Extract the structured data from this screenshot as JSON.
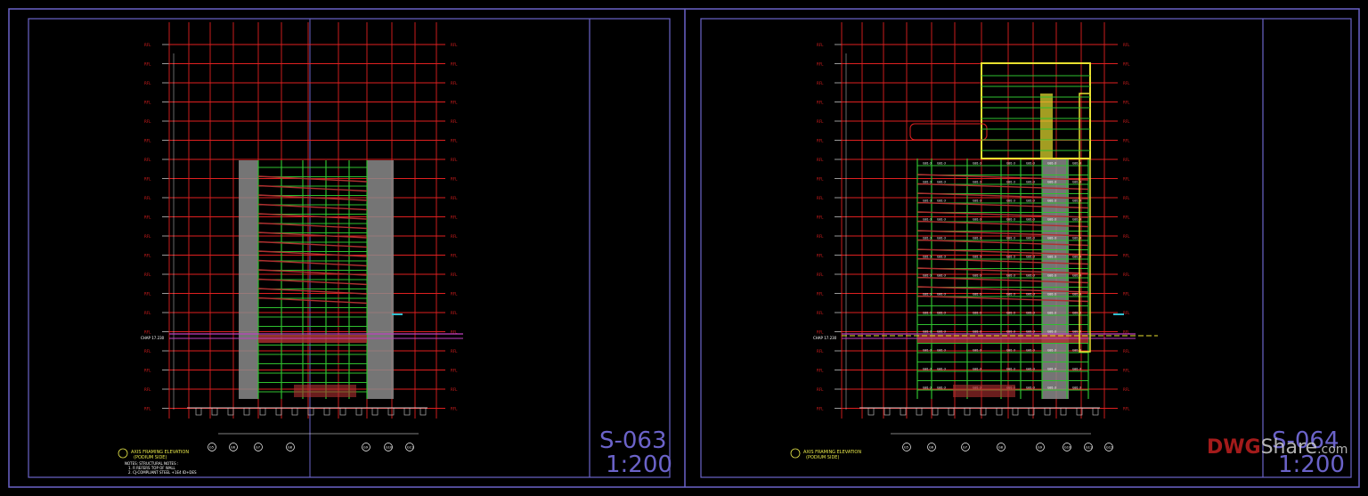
{
  "colors": {
    "frame": "#6b63c9",
    "floor_line": "#e02020",
    "column_line": "#e02020",
    "framing": "#2fbf2f",
    "core": "#8a8a8a",
    "brace": "#b03030",
    "highlight": "#e8e030",
    "magenta": "#c040c0",
    "cyan": "#30c0d0",
    "watermark_red": "#c02020",
    "watermark_white": "#d0d0d0"
  },
  "sheets": [
    {
      "id": "left",
      "sheet_number": "S-063",
      "scale": "1:200",
      "title": "AXIS FRAMING ELEVATION",
      "subtitle": "(PODIUM SIDE)",
      "notes": [
        "NOTES: STRUCTURAL NOTES :",
        "1. R REFERS TOP OF WALL",
        "2. CJ-COMPLIANT STEEL +1E4 ID+DES"
      ],
      "grid_bubbles": [
        "G5",
        "G6",
        "G7",
        "G8",
        "G9",
        "G10",
        "G11"
      ]
    },
    {
      "id": "right",
      "sheet_number": "S-064",
      "scale": "1:200",
      "title": "AXIS FRAMING ELEVATION",
      "subtitle": "(PODIUM SIDE)",
      "notes": [],
      "grid_bubbles": [
        "G5",
        "G6",
        "G7",
        "G8",
        "G9",
        "G10",
        "G11",
        "G12"
      ]
    }
  ],
  "watermark": {
    "part1": "DWG",
    "part2": "Share",
    "part3": ".com"
  },
  "beam_label": "GB1-3",
  "level_label": "RFL",
  "ground_label": "CHAP 17.230"
}
